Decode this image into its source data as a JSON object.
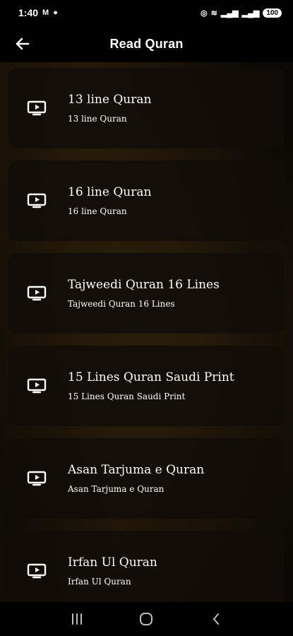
{
  "status": {
    "time": "1:40",
    "battery": "100"
  },
  "header": {
    "title": "Read Quran"
  },
  "items": [
    {
      "title": "13 line Quran",
      "subtitle": "13 line Quran"
    },
    {
      "title": "16 line Quran",
      "subtitle": "16 line Quran"
    },
    {
      "title": "Tajweedi Quran 16 Lines",
      "subtitle": "Tajweedi Quran 16 Lines"
    },
    {
      "title": "15 Lines Quran Saudi Print",
      "subtitle": "15 Lines Quran Saudi Print"
    },
    {
      "title": "Asan Tarjuma e Quran",
      "subtitle": "Asan Tarjuma e Quran"
    },
    {
      "title": "Irfan Ul Quran",
      "subtitle": "Irfan Ul Quran"
    }
  ],
  "icons": {
    "back": "arrow-left-icon",
    "item": "play-screen-icon",
    "nav_recents": "recents-icon",
    "nav_home": "home-icon",
    "nav_back": "back-chevron-icon"
  },
  "colors": {
    "background": "#000000",
    "card": "#120d08",
    "text": "#ffffff"
  }
}
